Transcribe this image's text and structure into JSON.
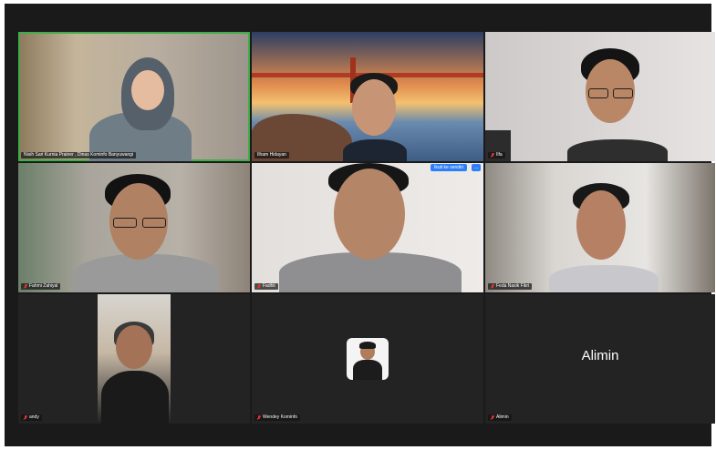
{
  "participants": [
    {
      "name": "Nisih Sari Kurnia Prainer , Dinas Kominfo Banyuwangi",
      "mic_muted": false
    },
    {
      "name": "Ilham Hidayan",
      "mic_muted": false
    },
    {
      "name": "Ilfa",
      "mic_muted": true
    },
    {
      "name": "Fahmi Zahiyal",
      "mic_muted": true
    },
    {
      "name": "Fadhli",
      "mic_muted": true
    },
    {
      "name": "Feda Nasik Fikri",
      "mic_muted": true
    },
    {
      "name": "andy",
      "mic_muted": true
    },
    {
      "name": "Wendey Kominfo",
      "mic_muted": true
    },
    {
      "name": "Alimin",
      "mic_muted": true
    }
  ],
  "alimin_display": "Alimin",
  "overlay": {
    "follow_label": "Ikuti ke sendiri",
    "more_label": "..."
  },
  "colors": {
    "active_speaker": "#3fae49",
    "muted_mic": "#e3342f",
    "tile_bg": "#242424"
  }
}
